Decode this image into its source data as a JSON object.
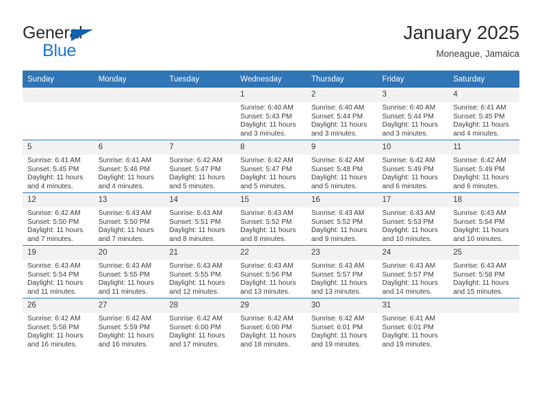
{
  "brand": {
    "name_part1": "General",
    "name_part2": "Blue",
    "triangle_color": "#1061ae",
    "blue_color": "#1675d1"
  },
  "header": {
    "title": "January 2025",
    "subtitle": "Moneague, Jamaica"
  },
  "theme": {
    "header_bg": "#3075b6",
    "daynum_bg": "#f2f2f2",
    "text": "#3a3a3a",
    "grid_line": "#3075b6"
  },
  "weekdays": [
    "Sunday",
    "Monday",
    "Tuesday",
    "Wednesday",
    "Thursday",
    "Friday",
    "Saturday"
  ],
  "weeks": [
    [
      {
        "day": "",
        "blank": true
      },
      {
        "day": "",
        "blank": true
      },
      {
        "day": "",
        "blank": true
      },
      {
        "day": "1",
        "sunrise": "Sunrise: 6:40 AM",
        "sunset": "Sunset: 5:43 PM",
        "daylight1": "Daylight: 11 hours",
        "daylight2": "and 3 minutes."
      },
      {
        "day": "2",
        "sunrise": "Sunrise: 6:40 AM",
        "sunset": "Sunset: 5:44 PM",
        "daylight1": "Daylight: 11 hours",
        "daylight2": "and 3 minutes."
      },
      {
        "day": "3",
        "sunrise": "Sunrise: 6:40 AM",
        "sunset": "Sunset: 5:44 PM",
        "daylight1": "Daylight: 11 hours",
        "daylight2": "and 3 minutes."
      },
      {
        "day": "4",
        "sunrise": "Sunrise: 6:41 AM",
        "sunset": "Sunset: 5:45 PM",
        "daylight1": "Daylight: 11 hours",
        "daylight2": "and 4 minutes."
      }
    ],
    [
      {
        "day": "5",
        "sunrise": "Sunrise: 6:41 AM",
        "sunset": "Sunset: 5:45 PM",
        "daylight1": "Daylight: 11 hours",
        "daylight2": "and 4 minutes."
      },
      {
        "day": "6",
        "sunrise": "Sunrise: 6:41 AM",
        "sunset": "Sunset: 5:46 PM",
        "daylight1": "Daylight: 11 hours",
        "daylight2": "and 4 minutes."
      },
      {
        "day": "7",
        "sunrise": "Sunrise: 6:42 AM",
        "sunset": "Sunset: 5:47 PM",
        "daylight1": "Daylight: 11 hours",
        "daylight2": "and 5 minutes."
      },
      {
        "day": "8",
        "sunrise": "Sunrise: 6:42 AM",
        "sunset": "Sunset: 5:47 PM",
        "daylight1": "Daylight: 11 hours",
        "daylight2": "and 5 minutes."
      },
      {
        "day": "9",
        "sunrise": "Sunrise: 6:42 AM",
        "sunset": "Sunset: 5:48 PM",
        "daylight1": "Daylight: 11 hours",
        "daylight2": "and 5 minutes."
      },
      {
        "day": "10",
        "sunrise": "Sunrise: 6:42 AM",
        "sunset": "Sunset: 5:49 PM",
        "daylight1": "Daylight: 11 hours",
        "daylight2": "and 6 minutes."
      },
      {
        "day": "11",
        "sunrise": "Sunrise: 6:42 AM",
        "sunset": "Sunset: 5:49 PM",
        "daylight1": "Daylight: 11 hours",
        "daylight2": "and 6 minutes."
      }
    ],
    [
      {
        "day": "12",
        "sunrise": "Sunrise: 6:42 AM",
        "sunset": "Sunset: 5:50 PM",
        "daylight1": "Daylight: 11 hours",
        "daylight2": "and 7 minutes."
      },
      {
        "day": "13",
        "sunrise": "Sunrise: 6:43 AM",
        "sunset": "Sunset: 5:50 PM",
        "daylight1": "Daylight: 11 hours",
        "daylight2": "and 7 minutes."
      },
      {
        "day": "14",
        "sunrise": "Sunrise: 6:43 AM",
        "sunset": "Sunset: 5:51 PM",
        "daylight1": "Daylight: 11 hours",
        "daylight2": "and 8 minutes."
      },
      {
        "day": "15",
        "sunrise": "Sunrise: 6:43 AM",
        "sunset": "Sunset: 5:52 PM",
        "daylight1": "Daylight: 11 hours",
        "daylight2": "and 8 minutes."
      },
      {
        "day": "16",
        "sunrise": "Sunrise: 6:43 AM",
        "sunset": "Sunset: 5:52 PM",
        "daylight1": "Daylight: 11 hours",
        "daylight2": "and 9 minutes."
      },
      {
        "day": "17",
        "sunrise": "Sunrise: 6:43 AM",
        "sunset": "Sunset: 5:53 PM",
        "daylight1": "Daylight: 11 hours",
        "daylight2": "and 10 minutes."
      },
      {
        "day": "18",
        "sunrise": "Sunrise: 6:43 AM",
        "sunset": "Sunset: 5:54 PM",
        "daylight1": "Daylight: 11 hours",
        "daylight2": "and 10 minutes."
      }
    ],
    [
      {
        "day": "19",
        "sunrise": "Sunrise: 6:43 AM",
        "sunset": "Sunset: 5:54 PM",
        "daylight1": "Daylight: 11 hours",
        "daylight2": "and 11 minutes."
      },
      {
        "day": "20",
        "sunrise": "Sunrise: 6:43 AM",
        "sunset": "Sunset: 5:55 PM",
        "daylight1": "Daylight: 11 hours",
        "daylight2": "and 11 minutes."
      },
      {
        "day": "21",
        "sunrise": "Sunrise: 6:43 AM",
        "sunset": "Sunset: 5:55 PM",
        "daylight1": "Daylight: 11 hours",
        "daylight2": "and 12 minutes."
      },
      {
        "day": "22",
        "sunrise": "Sunrise: 6:43 AM",
        "sunset": "Sunset: 5:56 PM",
        "daylight1": "Daylight: 11 hours",
        "daylight2": "and 13 minutes."
      },
      {
        "day": "23",
        "sunrise": "Sunrise: 6:43 AM",
        "sunset": "Sunset: 5:57 PM",
        "daylight1": "Daylight: 11 hours",
        "daylight2": "and 13 minutes."
      },
      {
        "day": "24",
        "sunrise": "Sunrise: 6:43 AM",
        "sunset": "Sunset: 5:57 PM",
        "daylight1": "Daylight: 11 hours",
        "daylight2": "and 14 minutes."
      },
      {
        "day": "25",
        "sunrise": "Sunrise: 6:43 AM",
        "sunset": "Sunset: 5:58 PM",
        "daylight1": "Daylight: 11 hours",
        "daylight2": "and 15 minutes."
      }
    ],
    [
      {
        "day": "26",
        "sunrise": "Sunrise: 6:42 AM",
        "sunset": "Sunset: 5:58 PM",
        "daylight1": "Daylight: 11 hours",
        "daylight2": "and 16 minutes."
      },
      {
        "day": "27",
        "sunrise": "Sunrise: 6:42 AM",
        "sunset": "Sunset: 5:59 PM",
        "daylight1": "Daylight: 11 hours",
        "daylight2": "and 16 minutes."
      },
      {
        "day": "28",
        "sunrise": "Sunrise: 6:42 AM",
        "sunset": "Sunset: 6:00 PM",
        "daylight1": "Daylight: 11 hours",
        "daylight2": "and 17 minutes."
      },
      {
        "day": "29",
        "sunrise": "Sunrise: 6:42 AM",
        "sunset": "Sunset: 6:00 PM",
        "daylight1": "Daylight: 11 hours",
        "daylight2": "and 18 minutes."
      },
      {
        "day": "30",
        "sunrise": "Sunrise: 6:42 AM",
        "sunset": "Sunset: 6:01 PM",
        "daylight1": "Daylight: 11 hours",
        "daylight2": "and 19 minutes."
      },
      {
        "day": "31",
        "sunrise": "Sunrise: 6:41 AM",
        "sunset": "Sunset: 6:01 PM",
        "daylight1": "Daylight: 11 hours",
        "daylight2": "and 19 minutes."
      },
      {
        "day": "",
        "blank": true
      }
    ]
  ]
}
